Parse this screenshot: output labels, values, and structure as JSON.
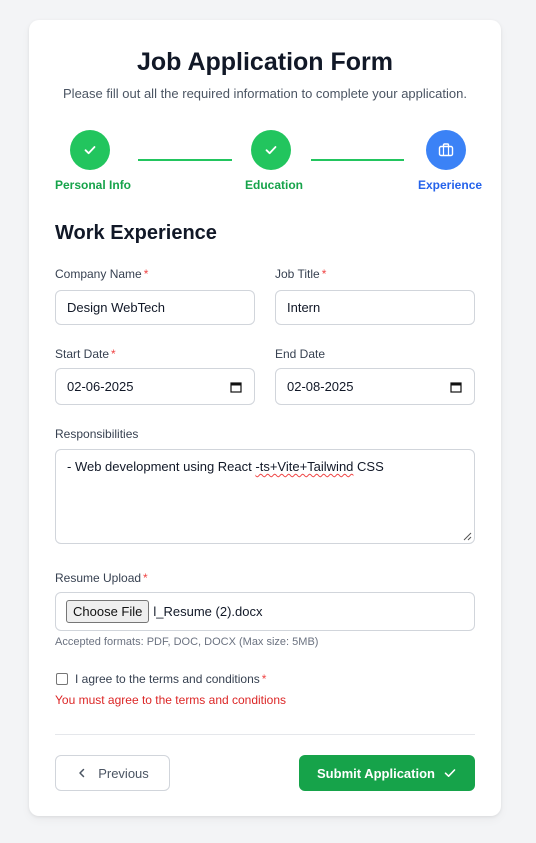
{
  "header": {
    "title": "Job Application Form",
    "subtitle": "Please fill out all the required information to complete your application."
  },
  "steps": [
    {
      "label": "Personal Info",
      "status": "complete",
      "icon": "check-icon"
    },
    {
      "label": "Education",
      "status": "complete",
      "icon": "check-icon"
    },
    {
      "label": "Experience",
      "status": "active",
      "icon": "briefcase-icon"
    }
  ],
  "section_title": "Work Experience",
  "fields": {
    "company_name": {
      "label": "Company Name",
      "required": "*",
      "value": "Design WebTech"
    },
    "job_title": {
      "label": "Job Title",
      "required": "*",
      "value": "Intern"
    },
    "start_date": {
      "label": "Start Date",
      "required": "*",
      "value": "02-06-2025"
    },
    "end_date": {
      "label": "End Date",
      "value": "02-08-2025"
    },
    "responsibilities": {
      "label": "Responsibilities",
      "value_pre": "- Web development using React ",
      "value_flagged": "-ts+Vite+Tailwind",
      "value_post": " CSS"
    },
    "resume": {
      "label": "Resume Upload",
      "required": "*",
      "button": "Choose File",
      "file_name": "l_Resume (2).docx",
      "hint": "Accepted formats: PDF, DOC, DOCX (Max size: 5MB)"
    }
  },
  "terms": {
    "label": "I agree to the terms and conditions",
    "required": "*",
    "checked": false,
    "error": "You must agree to the terms and conditions"
  },
  "buttons": {
    "previous": "Previous",
    "submit": "Submit Application"
  },
  "colors": {
    "success": "#22c55e",
    "active": "#3b82f6",
    "error": "#dc2626",
    "submit": "#16a34a"
  }
}
